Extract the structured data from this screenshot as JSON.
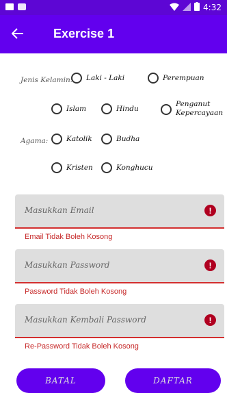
{
  "status_bar": {
    "time": "4:32",
    "icons": [
      "wifi-icon",
      "signal-icon",
      "battery-icon"
    ]
  },
  "app_bar": {
    "title": "Exercise 1",
    "back_icon": "arrow-back-icon"
  },
  "form": {
    "gender": {
      "label": "Jenis Kelamin:",
      "options": [
        "Laki - Laki",
        "Perempuan"
      ]
    },
    "religion": {
      "label": "Agama:",
      "options": [
        "Islam",
        "Hindu",
        "Penganut Kepercayaan",
        "Katolik",
        "Budha",
        "Kristen",
        "Konghucu"
      ]
    },
    "email": {
      "placeholder": "Masukkan Email",
      "error": "Email Tidak Boleh Kosong"
    },
    "password": {
      "placeholder": "Masukkan Password",
      "error": "Password Tidak Boleh Kosong"
    },
    "repassword": {
      "placeholder": "Masukkan Kembali Password",
      "error": "Re-Password Tidak Boleh Kosong"
    },
    "buttons": {
      "cancel": "BATAL",
      "submit": "DAFTAR"
    }
  },
  "colors": {
    "primary": "#6200ee",
    "status_bar": "#5d06d4",
    "error": "#b00020"
  }
}
